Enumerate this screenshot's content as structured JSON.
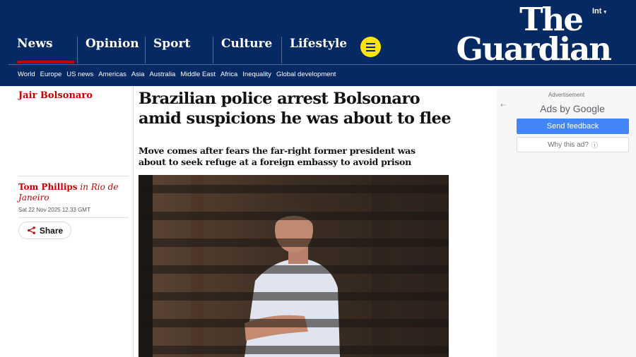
{
  "header": {
    "edition": "Int",
    "logo_line1": "The",
    "logo_line2": "Guardian",
    "pillars": [
      "News",
      "Opinion",
      "Sport",
      "Culture",
      "Lifestyle"
    ],
    "subnav": [
      "World",
      "Europe",
      "US news",
      "Americas",
      "Asia",
      "Australia",
      "Middle East",
      "Africa",
      "Inequality",
      "Global development"
    ]
  },
  "article": {
    "section": "Jair Bolsonaro",
    "headline": "Brazilian police arrest Bolsonaro amid suspicions he was about to flee",
    "standfirst": "Move comes after fears the far-right former president was about to seek refuge at a foreign embassy to avoid prison",
    "author": "Tom Phillips",
    "location": "in Rio de Janeiro",
    "date": "Sat 22 Nov 2025 12.33 GMT",
    "share_label": "Share"
  },
  "ad": {
    "label": "Advertisement",
    "ads_by": "Ads by Google",
    "send_feedback": "Send feedback",
    "why_ad": "Why this ad?"
  },
  "icons": {
    "menu": "menu-icon",
    "share": "share-icon",
    "info": "info-icon",
    "back": "back-arrow-icon"
  },
  "colors": {
    "brand_blue": "#052962",
    "news_red": "#c70000",
    "menu_yellow": "#ffe500",
    "feedback_blue": "#4285f4"
  }
}
